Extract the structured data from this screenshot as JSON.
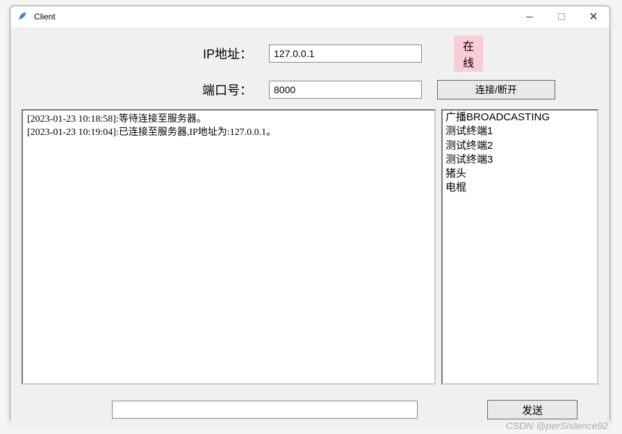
{
  "window": {
    "title": "Client",
    "controls": {
      "min": "minimize",
      "max": "maximize",
      "close": "close"
    }
  },
  "form": {
    "ip_label": "IP地址：",
    "ip_value": "127.0.0.1",
    "status_text": "在线",
    "port_label": "端口号：",
    "port_value": "8000",
    "connect_label": "连接/断开"
  },
  "log": {
    "lines": [
      "[2023-01-23 10:18:58]:等待连接至服务器。",
      "[2023-01-23 10:19:04]:已连接至服务器,IP地址为:127.0.0.1。"
    ]
  },
  "userlist": {
    "items": [
      "广播BROADCASTING",
      "测试终端1",
      "测试终端2",
      "测试终端3",
      "猪头",
      "电棍"
    ]
  },
  "bottom": {
    "message_value": "",
    "send_label": "发送"
  },
  "watermark": "CSDN @perSistence92"
}
